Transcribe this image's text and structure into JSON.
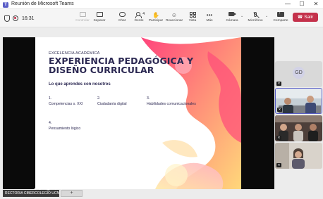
{
  "window": {
    "title": "Reunión de Microsoft Teams",
    "minimize": "—",
    "maximize": "☐",
    "close": "✕"
  },
  "toolbar": {
    "timer": "16:31",
    "buttons": [
      {
        "label": "Controlar",
        "disabled": true
      },
      {
        "label": "Separar"
      },
      {
        "label": "Chat"
      },
      {
        "label": "Gente",
        "badge": "4"
      },
      {
        "label": "Participar"
      },
      {
        "label": "Reaccionar"
      },
      {
        "label": "Vista"
      },
      {
        "label": "Más"
      },
      {
        "label": "Cámara"
      },
      {
        "label": "Micrófono"
      },
      {
        "label": "Comparte"
      }
    ],
    "leave_label": "Salir",
    "leave_color": "#c4314b"
  },
  "slide": {
    "kicker": "EXCELENCIA ACADÉMICA",
    "title_line1": "EXPERIENCIA PEDAGÓGICA Y",
    "title_line2": "DISEÑO CURRICULAR",
    "subtitle": "Lo que aprendes con nosotros",
    "items": [
      {
        "num": "1.",
        "text": "Competencias s. XXI"
      },
      {
        "num": "2.",
        "text": "Ciudadanía digital"
      },
      {
        "num": "3.",
        "text": "Habilidades comunicacionales"
      },
      {
        "num": "4.",
        "text": "Pensamiento lógico"
      }
    ],
    "accent_colors": [
      "#ff5a8a",
      "#ffa45c",
      "#ffd36b",
      "#ff2f6e"
    ]
  },
  "participants": {
    "avatar_initials": "GD",
    "mic_off_icon": "✕"
  },
  "presenter": {
    "name_tag": "RECTORIA CIBERCOLEGIO UCN",
    "add_label": "+"
  }
}
